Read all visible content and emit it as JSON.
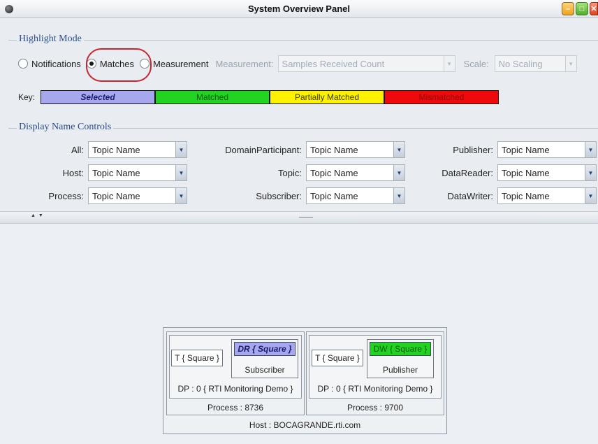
{
  "window": {
    "title": "System Overview Panel"
  },
  "highlight_mode": {
    "title": "Highlight Mode",
    "options": [
      {
        "label": "Notifications",
        "selected": false
      },
      {
        "label": "Matches",
        "selected": true
      },
      {
        "label": "Measurement",
        "selected": false
      }
    ],
    "measurement_label": "Measurement:",
    "measurement_value": "Samples Received Count",
    "scale_label": "Scale:",
    "scale_value": "No Scaling",
    "key_label": "Key:",
    "key": [
      {
        "label": "Selected",
        "color": "#a7a7ee",
        "text_color": "#1a1a6e"
      },
      {
        "label": "Matched",
        "color": "#22d322",
        "text_color": "#0a5a0a"
      },
      {
        "label": "Partially Matched",
        "color": "#fff200",
        "text_color": "#3a3a00"
      },
      {
        "label": "Mismatched",
        "color": "#ee0a0a",
        "text_color": "#8a0a0a"
      }
    ]
  },
  "display_name_controls": {
    "title": "Display Name Controls",
    "fields": [
      {
        "label": "All:",
        "value": "Topic Name"
      },
      {
        "label": "Host:",
        "value": "Topic Name"
      },
      {
        "label": "Process:",
        "value": "Topic Name"
      },
      {
        "label": "DomainParticipant:",
        "value": "Topic Name"
      },
      {
        "label": "Topic:",
        "value": "Topic Name"
      },
      {
        "label": "Subscriber:",
        "value": "Topic Name"
      },
      {
        "label": "Publisher:",
        "value": "Topic Name"
      },
      {
        "label": "DataReader:",
        "value": "Topic Name"
      },
      {
        "label": "DataWriter:",
        "value": "Topic Name"
      }
    ]
  },
  "diagram": {
    "host_label": "Host : BOCAGRANDE.rti.com",
    "processes": [
      {
        "process_label": "Process : 8736",
        "dp_label": "DP : 0 { RTI Monitoring Demo }",
        "topic_label": "T { Square }",
        "entity_tag": "DR { Square }",
        "entity_tag_color": "#a7a7ee",
        "entity_name": "Subscriber"
      },
      {
        "process_label": "Process : 9700",
        "dp_label": "DP : 0 { RTI Monitoring Demo }",
        "topic_label": "T { Square }",
        "entity_tag": "DW { Square }",
        "entity_tag_color": "#22d322",
        "entity_name": "Publisher"
      }
    ]
  }
}
